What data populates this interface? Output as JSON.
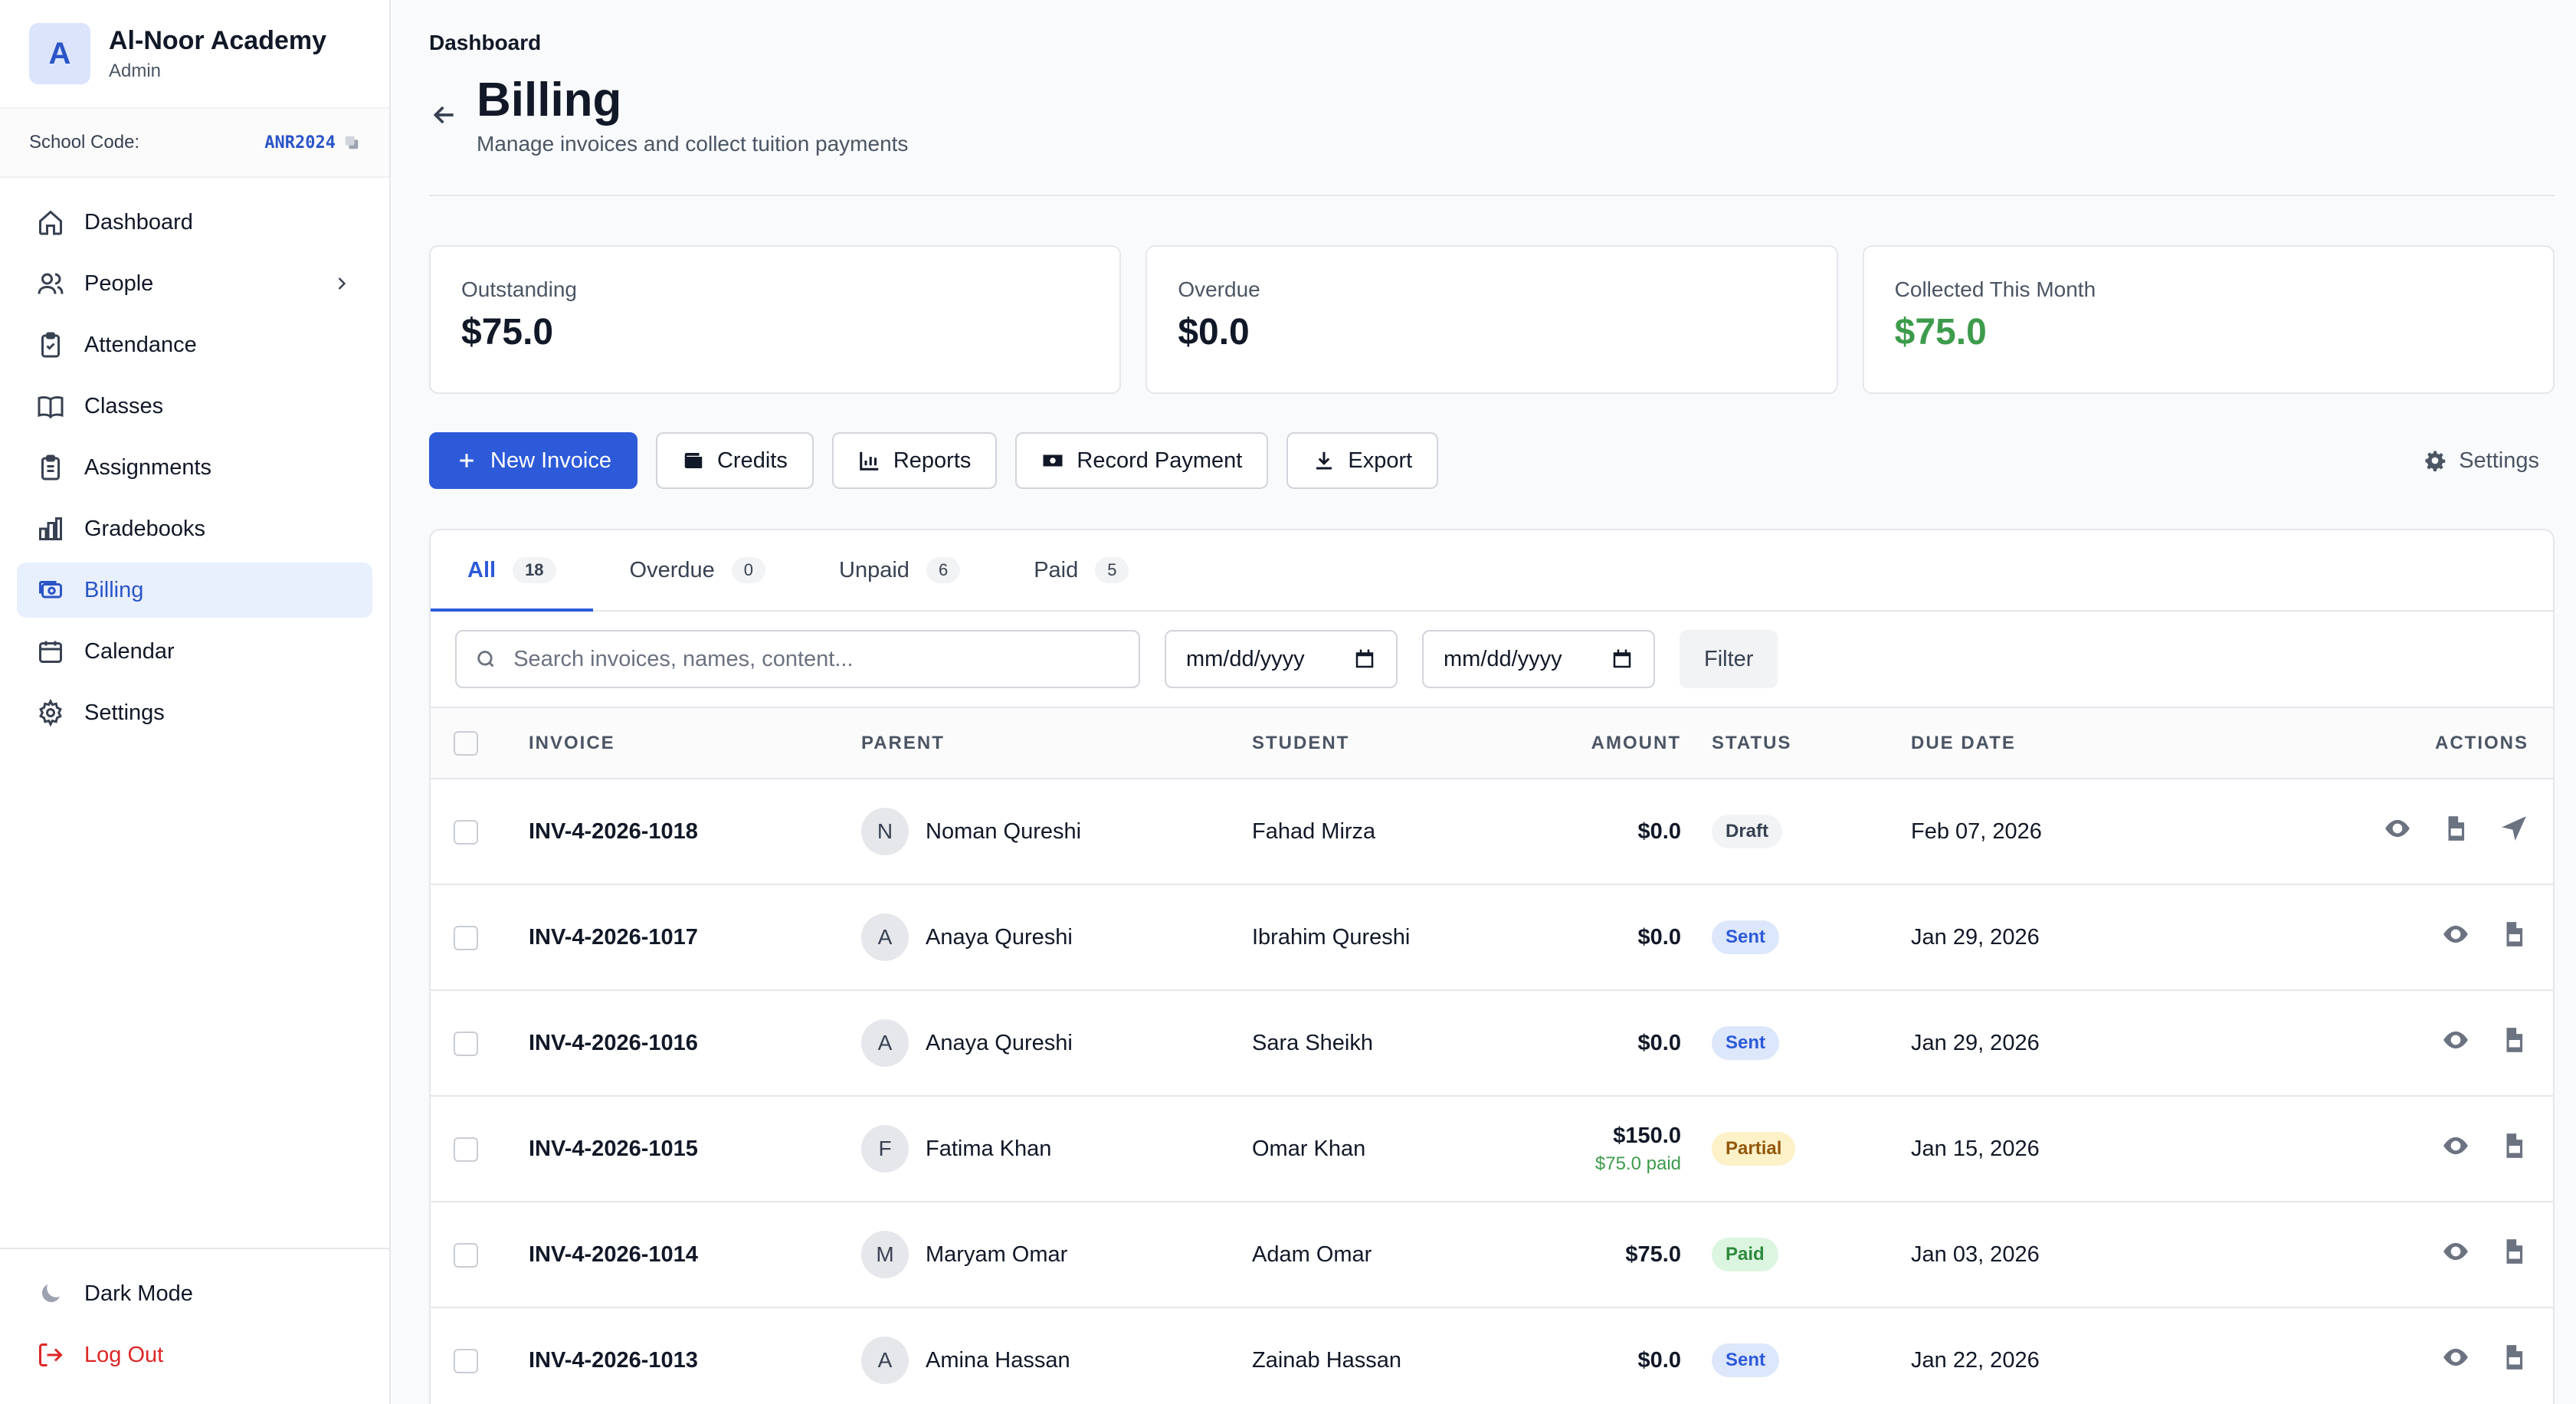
{
  "brand": {
    "initial": "A",
    "name": "Al-Noor Academy",
    "role": "Admin"
  },
  "school_code": {
    "label": "School Code:",
    "value": "ANR2024"
  },
  "nav": [
    {
      "label": "Dashboard",
      "icon": "home-icon"
    },
    {
      "label": "People",
      "icon": "users-icon"
    },
    {
      "label": "Attendance",
      "icon": "clipboard-check-icon"
    },
    {
      "label": "Classes",
      "icon": "book-icon"
    },
    {
      "label": "Assignments",
      "icon": "clipboard-icon"
    },
    {
      "label": "Gradebooks",
      "icon": "bar-chart-icon"
    },
    {
      "label": "Billing",
      "icon": "billing-icon"
    },
    {
      "label": "Calendar",
      "icon": "calendar-icon"
    },
    {
      "label": "Settings",
      "icon": "gear-icon"
    }
  ],
  "bottom": {
    "dark_mode": "Dark Mode",
    "logout": "Log Out"
  },
  "breadcrumb": "Dashboard",
  "page": {
    "title": "Billing",
    "subtitle": "Manage invoices and collect tuition payments"
  },
  "stats": [
    {
      "label": "Outstanding",
      "value": "$75.0"
    },
    {
      "label": "Overdue",
      "value": "$0.0"
    },
    {
      "label": "Collected This Month",
      "value": "$75.0"
    }
  ],
  "toolbar": {
    "new_invoice": "New Invoice",
    "credits": "Credits",
    "reports": "Reports",
    "record_payment": "Record Payment",
    "export": "Export",
    "settings": "Settings"
  },
  "tabs": [
    {
      "label": "All",
      "count": "18"
    },
    {
      "label": "Overdue",
      "count": "0"
    },
    {
      "label": "Unpaid",
      "count": "6"
    },
    {
      "label": "Paid",
      "count": "5"
    }
  ],
  "filters": {
    "search_placeholder": "Search invoices, names, content...",
    "date_from": "mm/dd/yyyy",
    "date_to": "mm/dd/yyyy",
    "filter": "Filter"
  },
  "columns": {
    "invoice": "INVOICE",
    "parent": "PARENT",
    "student": "STUDENT",
    "amount": "AMOUNT",
    "status": "STATUS",
    "due_date": "DUE DATE",
    "actions": "ACTIONS"
  },
  "rows": [
    {
      "invoice": "INV-4-2026-1018",
      "parent_initial": "N",
      "parent": "Noman Qureshi",
      "student": "Fahad Mirza",
      "amount": "$0.0",
      "paid": "",
      "status": "Draft",
      "due": "Feb 07, 2026"
    },
    {
      "invoice": "INV-4-2026-1017",
      "parent_initial": "A",
      "parent": "Anaya Qureshi",
      "student": "Ibrahim Qureshi",
      "amount": "$0.0",
      "paid": "",
      "status": "Sent",
      "due": "Jan 29, 2026"
    },
    {
      "invoice": "INV-4-2026-1016",
      "parent_initial": "A",
      "parent": "Anaya Qureshi",
      "student": "Sara Sheikh",
      "amount": "$0.0",
      "paid": "",
      "status": "Sent",
      "due": "Jan 29, 2026"
    },
    {
      "invoice": "INV-4-2026-1015",
      "parent_initial": "F",
      "parent": "Fatima Khan",
      "student": "Omar Khan",
      "amount": "$150.0",
      "paid": "$75.0 paid",
      "status": "Partial",
      "due": "Jan 15, 2026"
    },
    {
      "invoice": "INV-4-2026-1014",
      "parent_initial": "M",
      "parent": "Maryam Omar",
      "student": "Adam Omar",
      "amount": "$75.0",
      "paid": "",
      "status": "Paid",
      "due": "Jan 03, 2026"
    },
    {
      "invoice": "INV-4-2026-1013",
      "parent_initial": "A",
      "parent": "Amina Hassan",
      "student": "Zainab Hassan",
      "amount": "$0.0",
      "paid": "",
      "status": "Sent",
      "due": "Jan 22, 2026"
    }
  ],
  "colors": {
    "accent": "#2d5ad9",
    "green": "#3d9b4c",
    "danger": "#dc2626"
  }
}
